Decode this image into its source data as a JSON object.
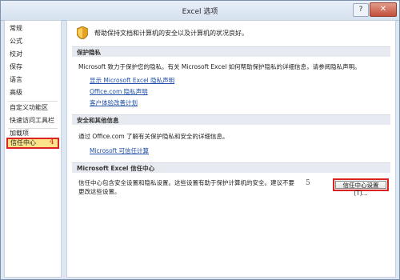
{
  "window": {
    "title": "Excel 选项",
    "help": "?",
    "close": "✕"
  },
  "nav": {
    "items": [
      "常规",
      "公式",
      "校对",
      "保存",
      "语言",
      "高级",
      "自定义功能区",
      "快速访问工具栏",
      "加载项",
      "信任中心"
    ],
    "selected": "信任中心",
    "step_marker": "4"
  },
  "main": {
    "intro": "帮助保持文档和计算机的安全以及计算机的状况良好。",
    "privacy": {
      "heading": "保护隐私",
      "text": "Microsoft 致力于保护您的隐私。有关 Microsoft Excel 如何帮助保护隐私的详细信息，请参阅隐私声明。",
      "links": [
        "显示 Microsoft Excel 隐私声明",
        "Office.com 隐私声明",
        "客户体验改善计划"
      ]
    },
    "security": {
      "heading": "安全和其他信息",
      "text": "通过 Office.com 了解有关保护隐私和安全的详细信息。",
      "link": "Microsoft 可信任计算"
    },
    "trust_center": {
      "heading": "Microsoft Excel 信任中心",
      "text": "信任中心包含安全设置和隐私设置。这些设置有助于保护计算机的安全。建议不要更改这些设置。",
      "step_marker": "5",
      "button": "信任中心设置(T)..."
    }
  },
  "colors": {
    "accent_red": "#d22222",
    "link_blue": "#1f4fa8",
    "selected_bg": "#fbe38a"
  }
}
